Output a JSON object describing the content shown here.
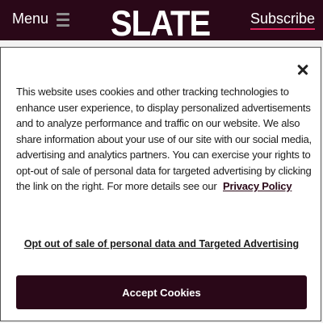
{
  "header": {
    "menu_label": "Menu",
    "logo": "SLATE",
    "subscribe_label": "Subscribe"
  },
  "consent": {
    "body_text": "This website uses cookies and other tracking technologies to enhance user experience, to display personalized advertisements and to analyze performance and traffic on our website. We also share information about your use of our site with our social media, advertising and analytics partners. You can exercise your rights to opt-out of sale of personal data for targeted advertising by clicking the link on the right. For more details see our",
    "privacy_link": "Privacy Policy",
    "optout_label": "Opt out of sale of personal data and Targeted Advertising",
    "accept_label": "Accept Cookies"
  },
  "colors": {
    "brand": "#2a0818",
    "subscribe_underline": "#e0245e"
  }
}
